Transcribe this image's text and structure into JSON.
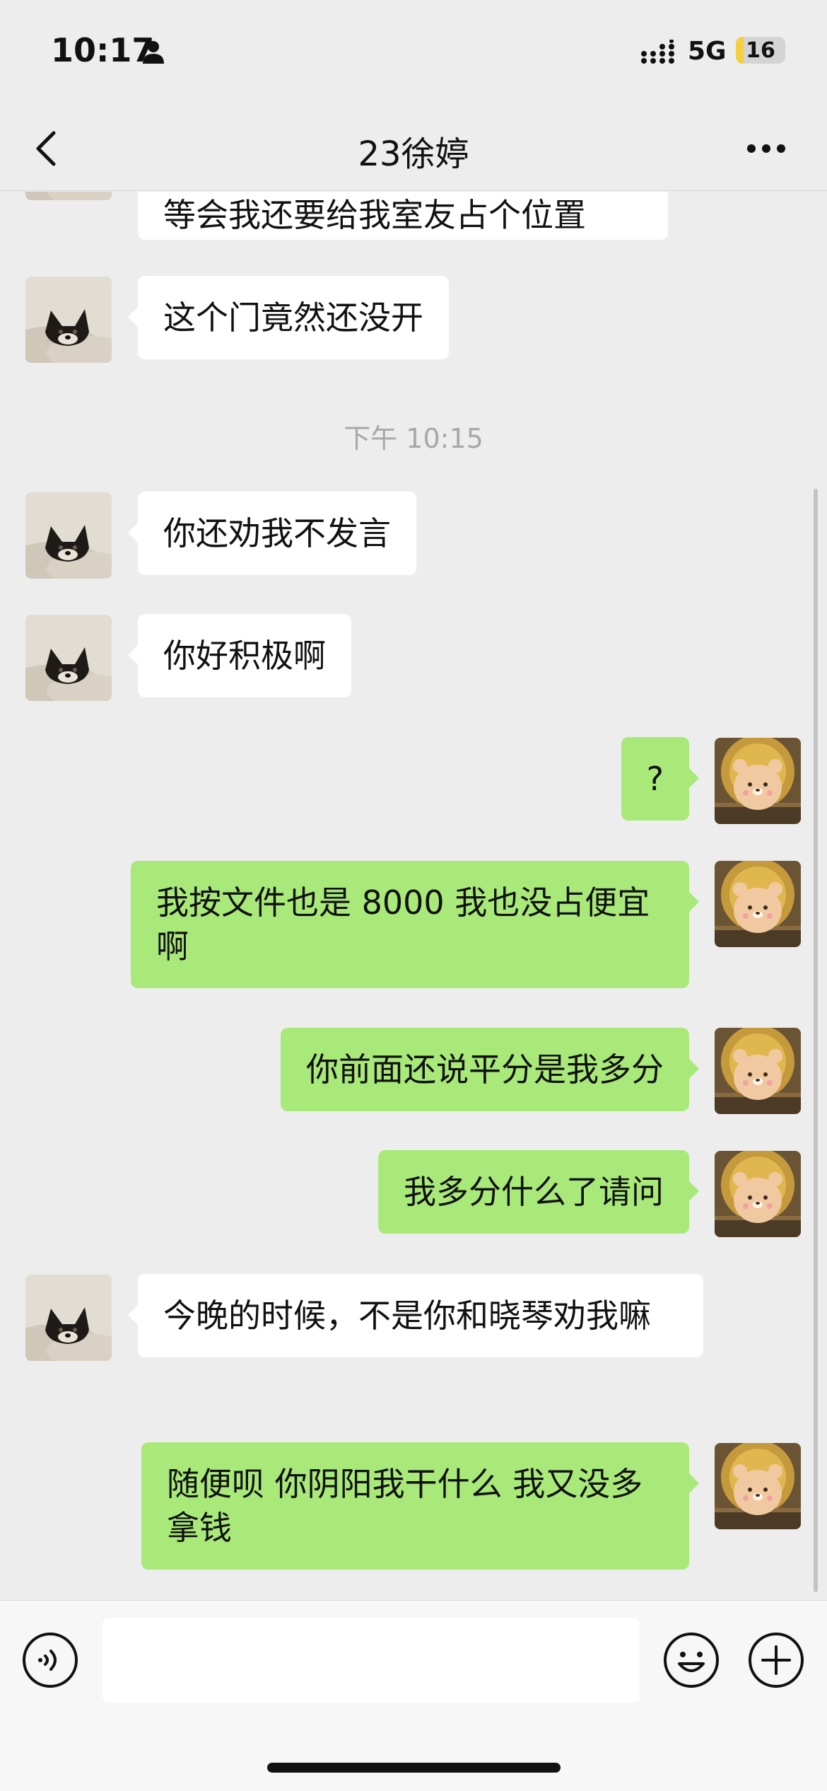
{
  "status_bar": {
    "time": "10:17",
    "network": "5G",
    "battery": "16",
    "battery_level": 0.16
  },
  "nav": {
    "title": "23徐婷"
  },
  "messages": [
    {
      "sender": "them",
      "text": "等会我还要给我室友占个位置"
    },
    {
      "sender": "them",
      "text": "这个门竟然还没开"
    },
    {
      "type": "time",
      "text": "下午 10:15"
    },
    {
      "sender": "them",
      "text": "你还劝我不发言"
    },
    {
      "sender": "them",
      "text": "你好积极啊"
    },
    {
      "sender": "me",
      "text": "?"
    },
    {
      "sender": "me",
      "text": "我按文件也是 8000 我也没占便宜啊"
    },
    {
      "sender": "me",
      "text": "你前面还说平分是我多分"
    },
    {
      "sender": "me",
      "text": "我多分什么了请问"
    },
    {
      "sender": "them",
      "text": "今晚的时候，不是你和晓琴劝我嘛"
    },
    {
      "sender": "me",
      "text": "随便呗 你阴阳我干什么 我又没多拿钱"
    }
  ],
  "colors": {
    "background": "#ededed",
    "outgoing_bubble": "#a9e97a",
    "incoming_bubble": "#ffffff"
  },
  "icons": {
    "back": "chevron-left-icon",
    "more": "more-dots-icon",
    "voice": "voice-icon",
    "emoji": "emoji-icon",
    "plus": "plus-icon"
  }
}
